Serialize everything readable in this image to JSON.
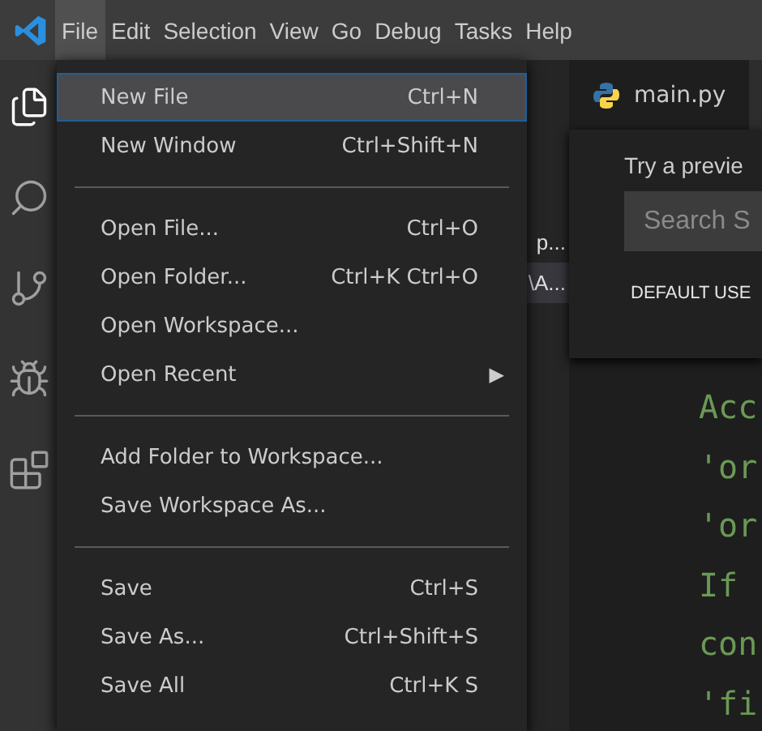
{
  "menubar": [
    {
      "label": "File",
      "selected": true
    },
    {
      "label": "Edit",
      "selected": false
    },
    {
      "label": "Selection",
      "selected": false
    },
    {
      "label": "View",
      "selected": false
    },
    {
      "label": "Go",
      "selected": false
    },
    {
      "label": "Debug",
      "selected": false
    },
    {
      "label": "Tasks",
      "selected": false
    },
    {
      "label": "Help",
      "selected": false
    }
  ],
  "activity_bar": [
    {
      "kind": "explorer",
      "selected": true
    },
    {
      "kind": "search",
      "selected": false
    },
    {
      "kind": "source-control",
      "selected": false
    },
    {
      "kind": "debug",
      "selected": false
    },
    {
      "kind": "extensions",
      "selected": false
    }
  ],
  "sidebar": {
    "rows": [
      {
        "text": "p...",
        "selected": false
      },
      {
        "text": "\\A...",
        "selected": true
      }
    ]
  },
  "file_menu": [
    {
      "kind": "item",
      "label": "New File",
      "shortcut": "Ctrl+N",
      "selected": true
    },
    {
      "kind": "item",
      "label": "New Window",
      "shortcut": "Ctrl+Shift+N",
      "selected": false
    },
    {
      "kind": "separator"
    },
    {
      "kind": "item",
      "label": "Open File...",
      "shortcut": "Ctrl+O",
      "selected": false
    },
    {
      "kind": "item",
      "label": "Open Folder...",
      "shortcut": "Ctrl+K Ctrl+O",
      "selected": false
    },
    {
      "kind": "item",
      "label": "Open Workspace...",
      "selected": false
    },
    {
      "kind": "submenu",
      "label": "Open Recent",
      "arrow": "▶",
      "selected": false
    },
    {
      "kind": "separator"
    },
    {
      "kind": "item",
      "label": "Add Folder to Workspace...",
      "selected": false
    },
    {
      "kind": "item",
      "label": "Save Workspace As...",
      "selected": false
    },
    {
      "kind": "separator"
    },
    {
      "kind": "item",
      "label": "Save",
      "shortcut": "Ctrl+S",
      "selected": false
    },
    {
      "kind": "item",
      "label": "Save As...",
      "shortcut": "Ctrl+Shift+S",
      "selected": false
    },
    {
      "kind": "item",
      "label": "Save All",
      "shortcut": "Ctrl+K S",
      "selected": false
    }
  ],
  "editor": {
    "tab": {
      "label": "main.py"
    },
    "settings_preview": {
      "text": "Try a previe",
      "search": {
        "placeholder": "Search S"
      },
      "section": "DEFAULT USE"
    },
    "code_lines": [
      "Acc",
      "'or",
      "'or",
      "If",
      "con",
      "'fi"
    ]
  }
}
